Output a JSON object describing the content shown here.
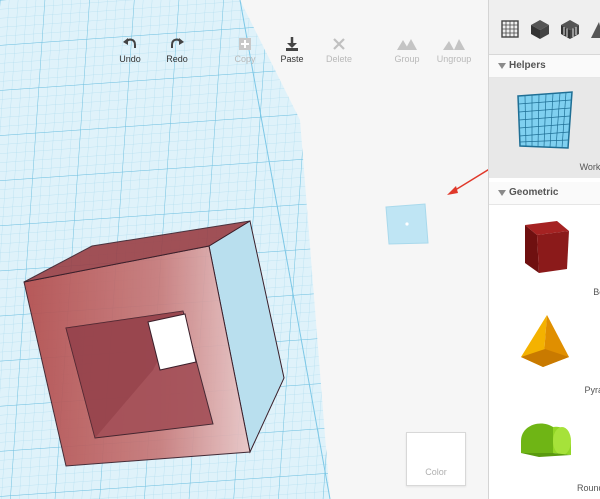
{
  "toolbar": {
    "undo": "Undo",
    "redo": "Redo",
    "copy": "Copy",
    "paste": "Paste",
    "delete": "Delete",
    "group": "Group",
    "ungroup": "Ungroup"
  },
  "color_panel": {
    "label": "Color"
  },
  "sidebar": {
    "tabs": [
      "grid-icon",
      "cube-icon",
      "striped-cube-icon",
      "more-icon"
    ],
    "sections": [
      {
        "title": "Helpers",
        "items": [
          {
            "label": "Workplane",
            "icon": "workplane-icon",
            "selected": true
          }
        ]
      },
      {
        "title": "Geometric",
        "items": [
          {
            "label": "Box",
            "icon": "box-icon",
            "color": "#8b1a1a"
          },
          {
            "label": "Pyramid",
            "icon": "pyramid-icon",
            "color": "#f0a000"
          },
          {
            "label": "Round Roof",
            "icon": "round-roof-icon",
            "color": "#8dcf1c"
          }
        ]
      }
    ]
  },
  "colors": {
    "grid_line": "#7cc7e6",
    "grid_fill": "#dff2fa",
    "shape_red": "#b04a4a",
    "arrow": "#e0382a"
  }
}
